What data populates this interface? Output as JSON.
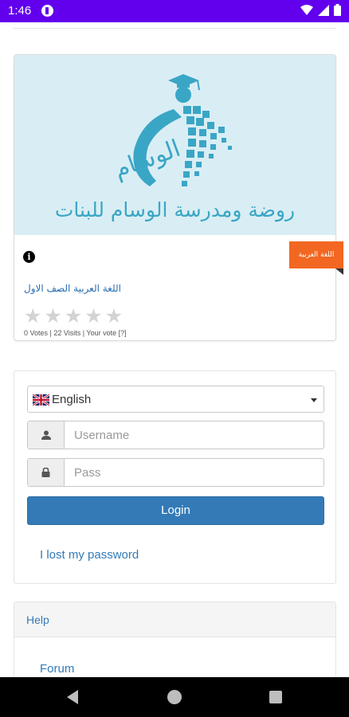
{
  "status_bar": {
    "time": "1:46"
  },
  "course": {
    "school_name": "روضة ومدرسة الوسام للبنات",
    "logo_lettering": "الوسام",
    "category_ribbon": "اللغة العربية",
    "title": "اللغة العربية الصف الاول",
    "rating_stars": 0,
    "rating_max": 5,
    "votes_text": "0 Votes | 22 Visits | Your vote [?]",
    "colors": {
      "banner": "#d9eef4",
      "ribbon": "#f26722",
      "logo_blue": "#3aa6c6"
    }
  },
  "login": {
    "language": "English",
    "username_placeholder": "Username",
    "password_placeholder": "Pass",
    "login_label": "Login",
    "lost_password_label": "I lost my password",
    "colors": {
      "primary": "#337ab7"
    }
  },
  "help": {
    "title": "Help",
    "forum_label": "Forum"
  },
  "icons": [
    "info-icon",
    "star-icon",
    "uk-flag-icon",
    "chevron-down-icon",
    "user-icon",
    "lock-icon",
    "back-icon",
    "home-icon",
    "recents-icon"
  ]
}
